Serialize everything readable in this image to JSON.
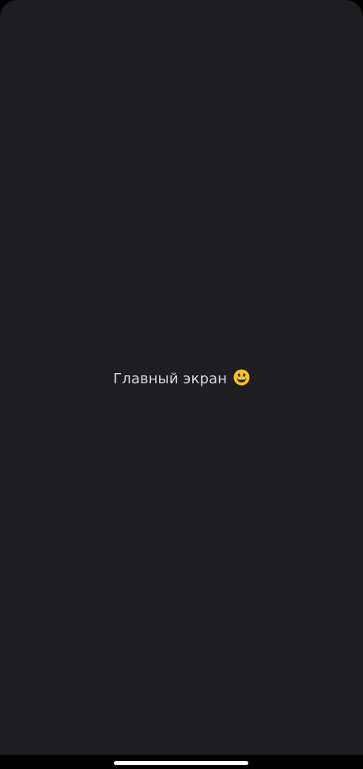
{
  "screen": {
    "title": "Главный экран",
    "emoji_icon": "grinning-face-icon",
    "background_color": "#1e1d21",
    "text_color": "#d8d8dc"
  },
  "system": {
    "navigation": "gesture-home-indicator",
    "nav_background": "#000000",
    "indicator_color": "#ffffff"
  }
}
